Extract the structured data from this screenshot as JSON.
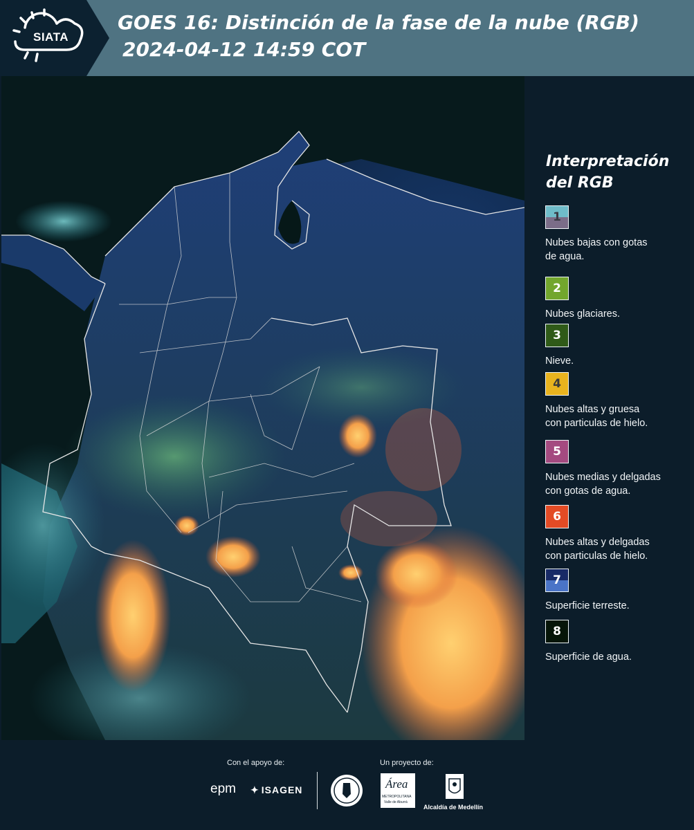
{
  "header": {
    "logo_text": "SIATA",
    "title_line1": "GOES 16: Distinción de la fase de la nube (RGB)",
    "title_line2": "2024-04-12 14:59 COT"
  },
  "legend": {
    "title_line1": "Interpretación",
    "title_line2": "del RGB",
    "items": [
      {
        "number": "1",
        "label_line1": "Nubes bajas con gotas",
        "label_line2": "de agua.",
        "color_top": "#6fbcc9",
        "color_bottom": "#7b6d88",
        "text_color": "#3a3a44"
      },
      {
        "number": "2",
        "label_line1": "Nubes glaciares.",
        "label_line2": "",
        "color_top": "#72a62d",
        "color_bottom": "#72a62d",
        "text_color": "#ffffff"
      },
      {
        "number": "3",
        "label_line1": "Nieve.",
        "label_line2": "",
        "color_top": "#2f5a18",
        "color_bottom": "#2f5a18",
        "text_color": "#ffffff"
      },
      {
        "number": "4",
        "label_line1": "Nubes altas y gruesa",
        "label_line2": "con particulas de hielo.",
        "color_top": "#e9b31e",
        "color_bottom": "#e9b31e",
        "text_color": "#3a3a3a"
      },
      {
        "number": "5",
        "label_line1": "Nubes medias y delgadas",
        "label_line2": "con gotas de agua.",
        "color_top": "#a44a80",
        "color_bottom": "#a44a80",
        "text_color": "#ffffff"
      },
      {
        "number": "6",
        "label_line1": "Nubes altas y delgadas",
        "label_line2": "con particulas de hielo.",
        "color_top": "#e34b25",
        "color_bottom": "#e34b25",
        "text_color": "#ffffff"
      },
      {
        "number": "7",
        "label_line1": "Superficie terreste.",
        "label_line2": "",
        "color_top": "#182a66",
        "color_bottom": "#4a74c7",
        "text_color": "#ffffff"
      },
      {
        "number": "8",
        "label_line1": "Superficie de agua.",
        "label_line2": "",
        "color_top": "#061508",
        "color_bottom": "#061508",
        "text_color": "#ffffff"
      }
    ]
  },
  "footer": {
    "support_label": "Con el apoyo de:",
    "project_label": "Un proyecto de:",
    "sponsor_epm": "epm",
    "sponsor_isagen": "ISAGEN",
    "partner_area": "Área",
    "partner_area_sub": "METROPOLITANA",
    "partner_area_sub2": "Valle de Aburrá",
    "partner_alcaldia": "Alcaldía de Medellín"
  },
  "colors": {
    "header_bg": "#4f7382",
    "panel_bg": "#0c1d2a",
    "land": "#1d3d78",
    "border_lines": "#e6e6e6",
    "storm_core": "#ffb347",
    "storm_edge": "#e05a2a"
  }
}
